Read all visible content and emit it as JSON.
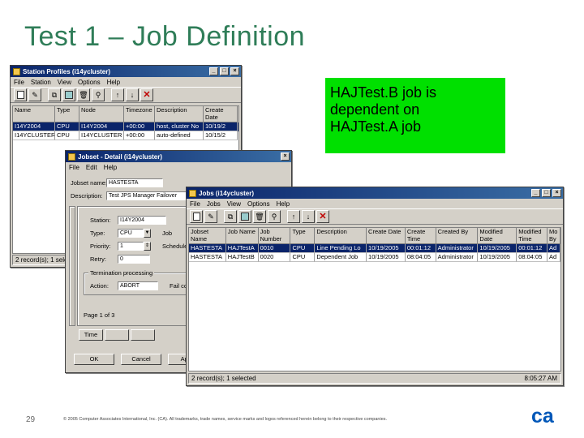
{
  "slide": {
    "title": "Test 1 – Job Definition",
    "callout_lines": [
      "HAJTest.B job is",
      "dependent on",
      "HAJTest.A job"
    ],
    "page_number": "29",
    "footer": "© 2005 Computer Associates International, Inc. (CA). All trademarks, trade names, service marks and logos referenced herein belong to their respective companies."
  },
  "station_window": {
    "title": "Station Profiles (i14ycluster)",
    "menu": [
      "File",
      "Station",
      "View",
      "Options",
      "Help"
    ],
    "columns": [
      "Name",
      "Type",
      "Node",
      "Timezone",
      "Description",
      "Create Date"
    ],
    "rows": [
      [
        "I14Y2004",
        "CPU",
        "I14Y2004",
        "+00:00",
        "host, cluster No",
        "10/19/2"
      ],
      [
        "I14YCLUSTER",
        "CPU",
        "I14YCLUSTER",
        "+00:00",
        "auto-defined",
        "10/15/2"
      ]
    ],
    "status": "2 record(s); 1 sele"
  },
  "jobset_window": {
    "title": "Jobset - Detail (i14ycluster)",
    "menu": [
      "File",
      "Edit",
      "Help"
    ],
    "jobset_name_label": "Jobset name:",
    "jobset_name_value": "HASTESTA",
    "description_label": "Description:",
    "description_value": "Test JPS Manager Failover",
    "station_label": "Station:",
    "station_value": "I14Y2004",
    "type_label": "Type:",
    "type_value": "CPU",
    "priority_label": "Priority:",
    "priority_value": "1",
    "jobs_label": "Job",
    "schedule_label": "Schedule",
    "retry_label": "Retry:",
    "retry_value": "0",
    "termination_label": "Termination processing",
    "action_label": "Action:",
    "action_value": "ABORT",
    "fail_codes_label": "Fail codes:",
    "page_label": "Page 1 of 3",
    "tab_labels": [
      "Time",
      "",
      ""
    ],
    "button_labels": [
      "OK",
      "Cancel",
      "Apply"
    ]
  },
  "jobs_window": {
    "title": "Jobs (i14ycluster)",
    "menu": [
      "File",
      "Jobs",
      "View",
      "Options",
      "Help"
    ],
    "columns": [
      "Jobset Name",
      "Job Name",
      "Job Number",
      "Type",
      "Description",
      "Create Date",
      "Create Time",
      "Created By",
      "Modified Date",
      "Modified Time",
      "Mo By"
    ],
    "rows": [
      [
        "HASTESTA",
        "HAJTestA",
        "0010",
        "CPU",
        "Line Pending Lo",
        "10/19/2005",
        "00:01:12",
        "Administrator",
        "10/19/2005",
        "00:01:12",
        "Ad"
      ],
      [
        "HASTESTA",
        "HAJTestB",
        "0020",
        "CPU",
        "Dependent Job",
        "10/19/2005",
        "08:04:05",
        "Administrator",
        "10/19/2005",
        "08:04:05",
        "Ad"
      ]
    ],
    "status_left": "2 record(s); 1 selected",
    "status_right": "8:05:27 AM"
  },
  "logo_text": "ca",
  "colors": {
    "title": "#2f7d58",
    "callout": "#00e000",
    "titlebar": "#0a246a",
    "logo": "#0057b8"
  }
}
